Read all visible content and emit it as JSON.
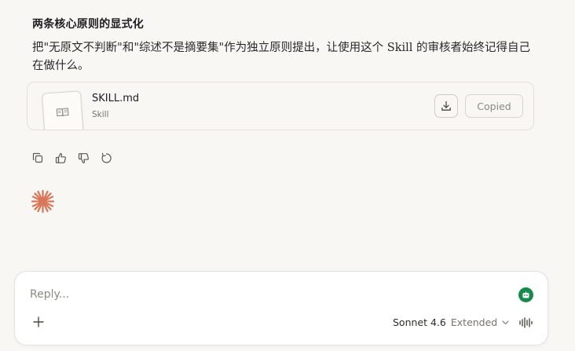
{
  "message": {
    "heading": "两条核心原则的显式化",
    "paragraph": "把\"无原文不判断\"和\"综述不是摘要集\"作为独立原则提出，让使用这个 Skill 的审核者始终记得自己在做什么。"
  },
  "attachment": {
    "file_name": "SKILL.md",
    "file_type": "Skill",
    "thumb_icon": "book-icon",
    "download_icon": "download-icon",
    "copied_label": "Copied"
  },
  "message_actions": [
    "copy-icon",
    "thumbs-up-icon",
    "thumbs-down-icon",
    "retry-icon"
  ],
  "composer": {
    "placeholder": "Reply...",
    "model_name": "Sonnet 4.6",
    "mode": "Extended",
    "add_icon": "plus-icon",
    "voice_icon": "voice-waveform-icon",
    "bot_icon": "robot-icon"
  },
  "colors": {
    "background": "#f8f7f3",
    "accent_spark": "#d9775a",
    "bot_badge": "#168a4a"
  }
}
